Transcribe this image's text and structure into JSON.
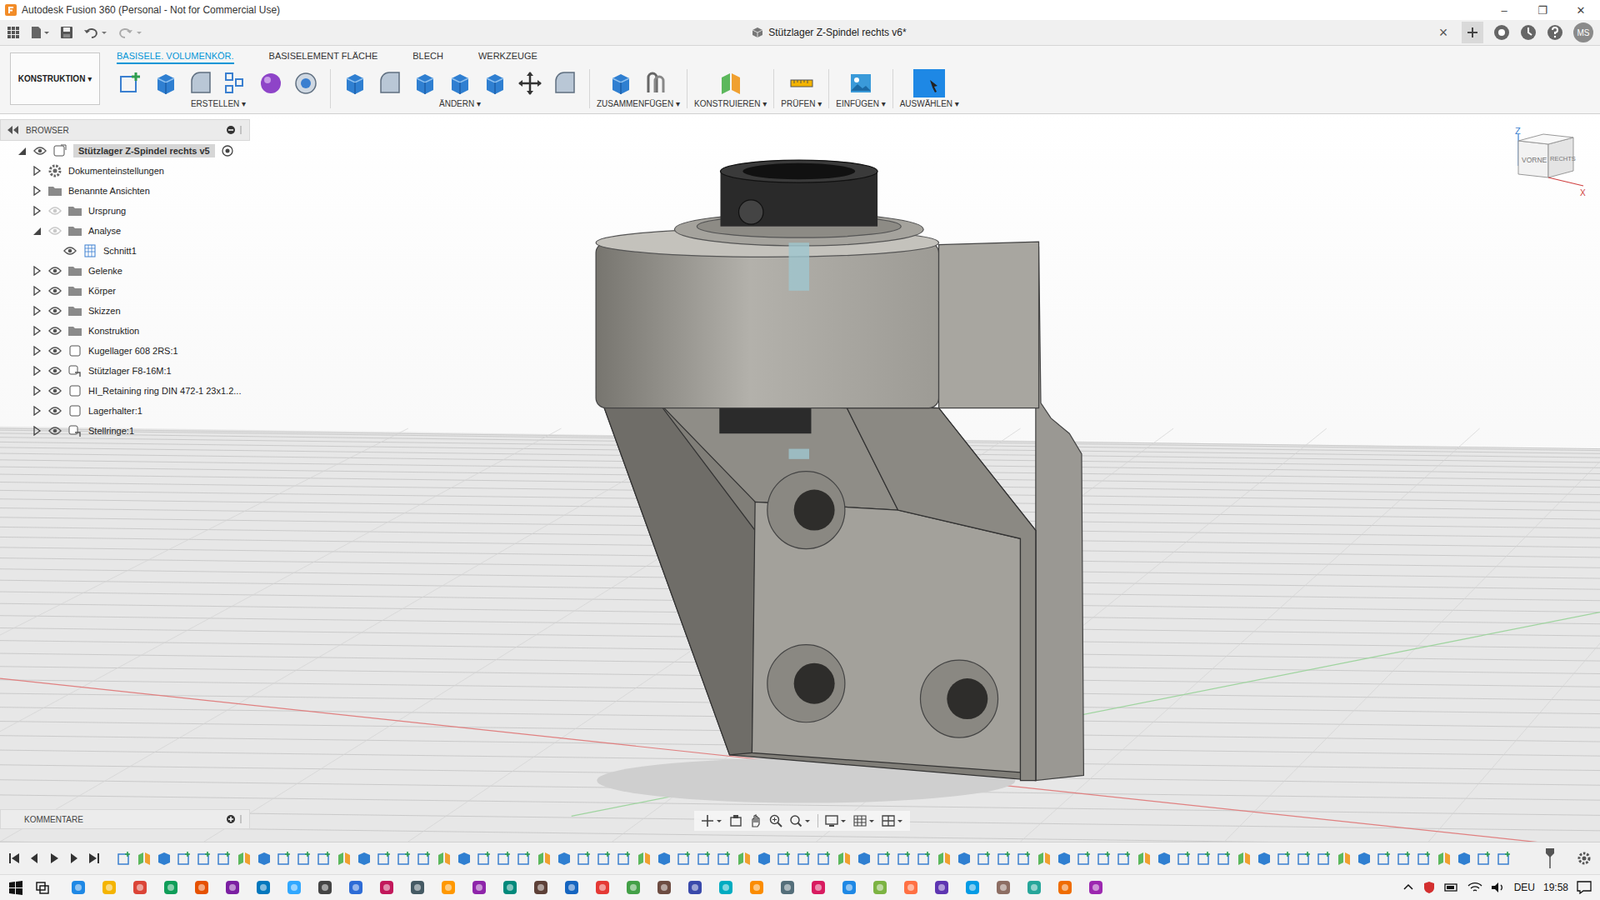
{
  "window": {
    "title": "Autodesk Fusion 360 (Personal - Not for Commercial Use)",
    "controls": [
      "–",
      "❐",
      "✕"
    ]
  },
  "document": {
    "title": "Stützlager Z-Spindel rechts v6*",
    "close": "×",
    "user": "MS"
  },
  "toolbar": {
    "workspace": "KONSTRUKTION ▾",
    "tabs": [
      {
        "label": "BASISELE. VOLUMENKÖR.",
        "selected": true
      },
      {
        "label": "BASISELEMENT FLÄCHE",
        "selected": false
      },
      {
        "label": "BLECH",
        "selected": false
      },
      {
        "label": "WERKZEUGE",
        "selected": false
      }
    ],
    "groups": [
      {
        "label": "ERSTELLEN ▾",
        "highlighted": false
      },
      {
        "label": "ÄNDERN ▾",
        "highlighted": false
      },
      {
        "label": "ZUSAMMENFÜGEN ▾",
        "highlighted": false
      },
      {
        "label": "KONSTRUIEREN ▾",
        "highlighted": false
      },
      {
        "label": "PRÜFEN ▾",
        "highlighted": false
      },
      {
        "label": "EINFÜGEN ▾",
        "highlighted": false
      },
      {
        "label": "AUSWÄHLEN ▾",
        "highlighted": true
      }
    ]
  },
  "browser": {
    "title": "BROWSER",
    "items": [
      {
        "label": "Stützlager Z-Spindel rechts v5",
        "level": 0,
        "kind": "root",
        "has_children": true,
        "expanded": true,
        "eye": true,
        "visible": true
      },
      {
        "label": "Dokumenteinstellungen",
        "level": 1,
        "kind": "settings",
        "has_children": true,
        "expanded": false,
        "eye": false,
        "visible": true
      },
      {
        "label": "Benannte Ansichten",
        "level": 1,
        "kind": "folder",
        "has_children": true,
        "expanded": false,
        "eye": false,
        "visible": true
      },
      {
        "label": "Ursprung",
        "level": 1,
        "kind": "folder",
        "has_children": true,
        "expanded": false,
        "eye": true,
        "visible": false
      },
      {
        "label": "Analyse",
        "level": 1,
        "kind": "folder",
        "has_children": true,
        "expanded": true,
        "eye": true,
        "visible": false
      },
      {
        "label": "Schnitt1",
        "level": 2,
        "kind": "section",
        "has_children": false,
        "expanded": false,
        "eye": true,
        "visible": true
      },
      {
        "label": "Gelenke",
        "level": 1,
        "kind": "folder",
        "has_children": true,
        "expanded": false,
        "eye": true,
        "visible": true
      },
      {
        "label": "Körper",
        "level": 1,
        "kind": "folder",
        "has_children": true,
        "expanded": false,
        "eye": true,
        "visible": true
      },
      {
        "label": "Skizzen",
        "level": 1,
        "kind": "folder",
        "has_children": true,
        "expanded": false,
        "eye": true,
        "visible": true
      },
      {
        "label": "Konstruktion",
        "level": 1,
        "kind": "folder",
        "has_children": true,
        "expanded": false,
        "eye": true,
        "visible": true
      },
      {
        "label": "Kugellager 608 2RS:1",
        "level": 1,
        "kind": "component",
        "has_children": true,
        "expanded": false,
        "eye": true,
        "visible": true
      },
      {
        "label": "Stützlager F8-16M:1",
        "level": 1,
        "kind": "linked",
        "has_children": true,
        "expanded": false,
        "eye": true,
        "visible": true
      },
      {
        "label": "HI_Retaining ring DIN 472-1 23x1.2...",
        "level": 1,
        "kind": "component",
        "has_children": true,
        "expanded": false,
        "eye": true,
        "visible": true
      },
      {
        "label": "Lagerhalter:1",
        "level": 1,
        "kind": "component",
        "has_children": true,
        "expanded": false,
        "eye": true,
        "visible": true
      },
      {
        "label": "Stellringe:1",
        "level": 1,
        "kind": "linked",
        "has_children": true,
        "expanded": false,
        "eye": true,
        "visible": true
      }
    ]
  },
  "comments": {
    "title": "KOMMENTARE"
  },
  "viewcube": {
    "front": "VORNE",
    "right": "RECHTS",
    "z": "Z",
    "x": "X"
  },
  "taskbar": {
    "language": "DEU",
    "time": "19:58"
  }
}
